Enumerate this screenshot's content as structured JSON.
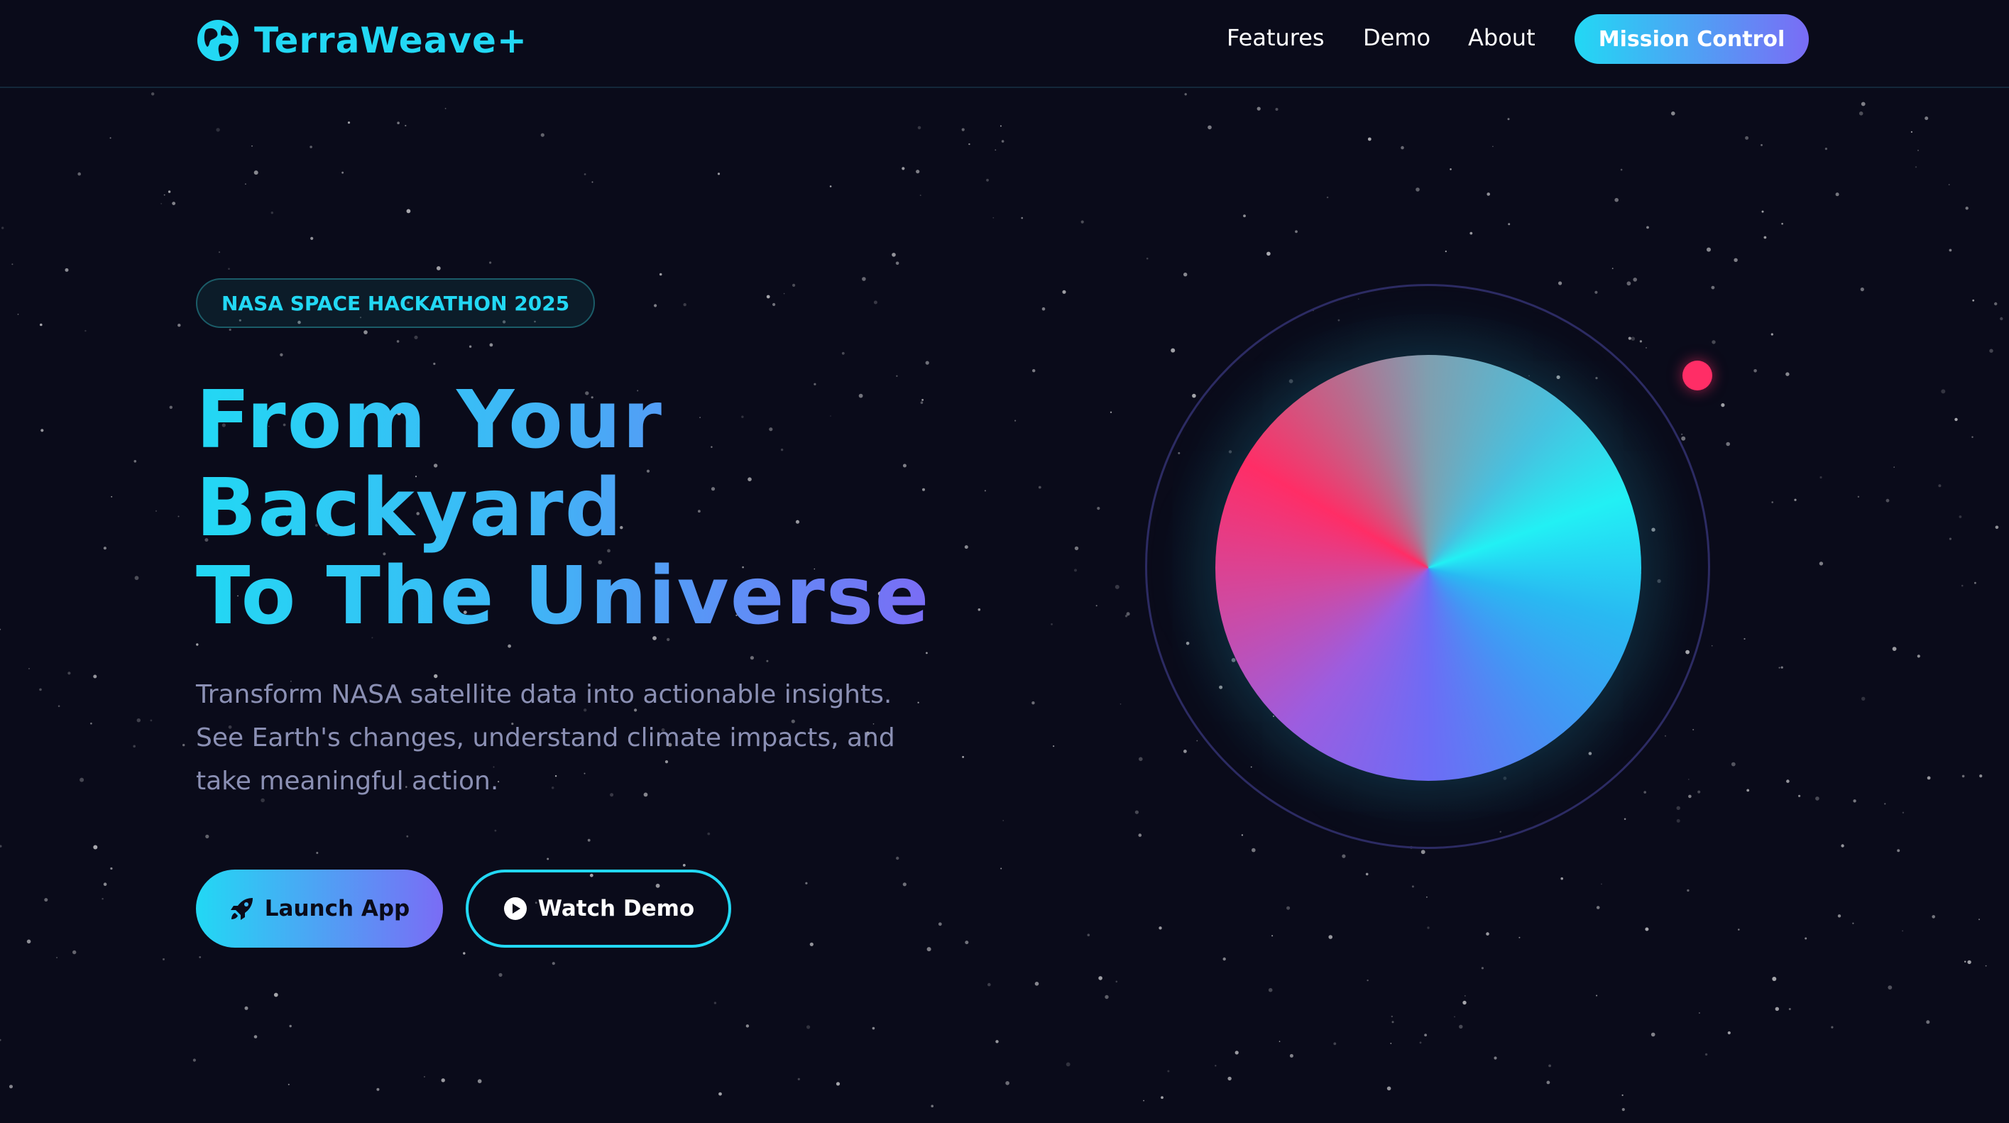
{
  "header": {
    "logo_text": "TerraWeave+",
    "logo_icon": "globe-icon",
    "nav": [
      {
        "label": "Features"
      },
      {
        "label": "Demo"
      },
      {
        "label": "About"
      }
    ],
    "cta_label": "Mission Control"
  },
  "hero": {
    "badge": "NASA SPACE HACKATHON 2025",
    "title_lines": [
      "From Your",
      "Backyard",
      "To The Universe"
    ],
    "description_lines": [
      "Transform NASA satellite data into actionable insights.",
      "See Earth's changes, understand climate impacts, and",
      "take meaningful action."
    ],
    "launch_label": "Launch App",
    "launch_icon": "rocket-icon",
    "watch_label": "Watch Demo",
    "watch_icon": "play-circle-icon"
  },
  "colors": {
    "background": "#0a0b1a",
    "accent_cyan": "#22d8f4",
    "accent_violet": "#7a6cf5",
    "accent_pink": "#ff2d66",
    "body_text": "#8b90b4"
  }
}
